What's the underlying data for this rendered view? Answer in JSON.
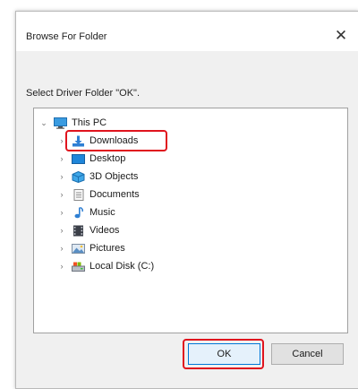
{
  "dialog": {
    "title": "Browse For Folder",
    "instruction": "Select Driver Folder \"OK\".",
    "close_glyph": "✕"
  },
  "tree": {
    "root": {
      "label": "This PC",
      "expander": "⌄",
      "icon": "computer-icon"
    },
    "items": [
      {
        "label": "Downloads",
        "icon": "downloads-icon",
        "expander": "›",
        "highlighted": true
      },
      {
        "label": "Desktop",
        "icon": "desktop-icon",
        "expander": "›"
      },
      {
        "label": "3D Objects",
        "icon": "3d-objects-icon",
        "expander": "›"
      },
      {
        "label": "Documents",
        "icon": "documents-icon",
        "expander": "›"
      },
      {
        "label": "Music",
        "icon": "music-icon",
        "expander": "›"
      },
      {
        "label": "Videos",
        "icon": "videos-icon",
        "expander": "›"
      },
      {
        "label": "Pictures",
        "icon": "pictures-icon",
        "expander": "›"
      },
      {
        "label": "Local Disk (C:)",
        "icon": "local-disk-icon",
        "expander": "›"
      }
    ]
  },
  "buttons": {
    "ok": "OK",
    "cancel": "Cancel"
  },
  "colors": {
    "highlight": "#e0141e",
    "accent": "#0078d7"
  }
}
